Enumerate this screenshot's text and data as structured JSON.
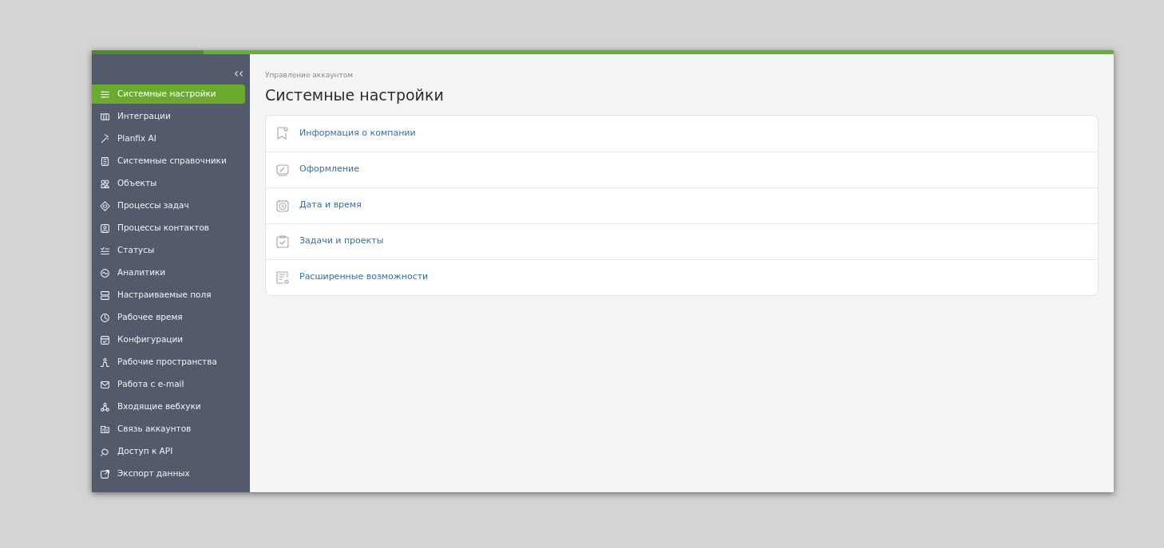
{
  "sidebar": {
    "collapse_label": "‹‹",
    "items": [
      {
        "label": "Системные настройки",
        "selected": true
      },
      {
        "label": "Интеграции",
        "selected": false
      },
      {
        "label": "Planfix AI",
        "selected": false
      },
      {
        "label": "Системные справочники",
        "selected": false
      },
      {
        "label": "Объекты",
        "selected": false
      },
      {
        "label": "Процессы задач",
        "selected": false
      },
      {
        "label": "Процессы контактов",
        "selected": false
      },
      {
        "label": "Статусы",
        "selected": false
      },
      {
        "label": "Аналитики",
        "selected": false
      },
      {
        "label": "Настраиваемые поля",
        "selected": false
      },
      {
        "label": "Рабочее время",
        "selected": false
      },
      {
        "label": "Конфигурации",
        "selected": false
      },
      {
        "label": "Рабочие пространства",
        "selected": false
      },
      {
        "label": "Работа с e-mail",
        "selected": false
      },
      {
        "label": "Входящие вебхуки",
        "selected": false
      },
      {
        "label": "Связь аккаунтов",
        "selected": false
      },
      {
        "label": "Доступ к API",
        "selected": false
      },
      {
        "label": "Экспорт данных",
        "selected": false
      }
    ]
  },
  "breadcrumb": "Управление аккаунтом",
  "title": "Системные настройки",
  "sections": [
    {
      "label": "Информация о компании"
    },
    {
      "label": "Оформление"
    },
    {
      "label": "Дата и время"
    },
    {
      "label": "Задачи и проекты"
    },
    {
      "label": "Расширенные возможности"
    }
  ]
}
